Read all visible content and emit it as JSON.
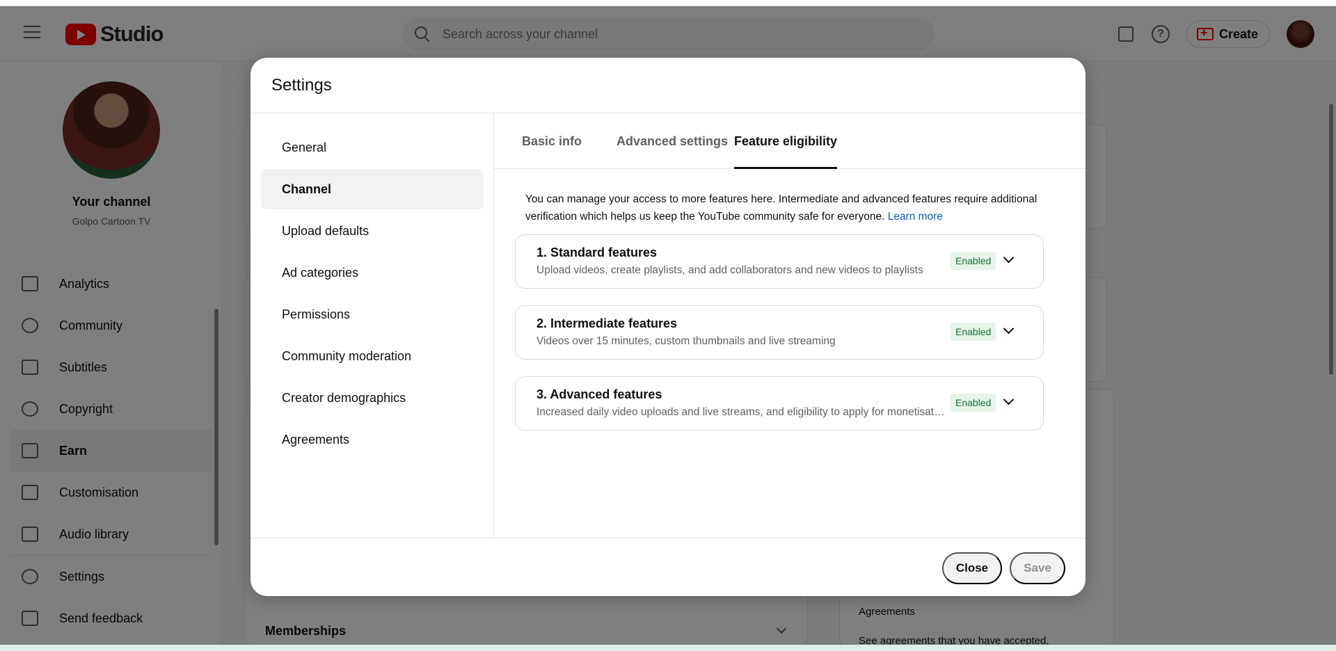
{
  "header": {
    "logo_text": "Studio",
    "search_placeholder": "Search across your channel",
    "create_label": "Create"
  },
  "sidebar": {
    "channel_title": "Your channel",
    "channel_name": "Golpo Cartoon TV",
    "items": [
      {
        "label": "Analytics",
        "icon": "analytics-icon"
      },
      {
        "label": "Community",
        "icon": "community-icon"
      },
      {
        "label": "Subtitles",
        "icon": "subtitles-icon"
      },
      {
        "label": "Copyright",
        "icon": "copyright-icon"
      },
      {
        "label": "Earn",
        "icon": "dollar-icon",
        "active": true
      },
      {
        "label": "Customisation",
        "icon": "magic-wand-icon"
      },
      {
        "label": "Audio library",
        "icon": "music-library-icon"
      }
    ],
    "bottom_items": [
      {
        "label": "Settings",
        "icon": "gear-icon"
      },
      {
        "label": "Send feedback",
        "icon": "feedback-icon"
      }
    ]
  },
  "background": {
    "memberships_label": "Memberships",
    "agreements_label": "Agreements",
    "agreements_text": "See agreements that you have accepted,"
  },
  "dialog": {
    "title": "Settings",
    "nav": [
      "General",
      "Channel",
      "Upload defaults",
      "Ad categories",
      "Permissions",
      "Community moderation",
      "Creator demographics",
      "Agreements"
    ],
    "active_nav": "Channel",
    "tabs": [
      "Basic info",
      "Advanced settings",
      "Feature eligibility"
    ],
    "active_tab": "Feature eligibility",
    "description": "You can manage your access to more features here. Intermediate and advanced features require additional verification which helps us keep the YouTube community safe for everyone.",
    "learn_more": "Learn more",
    "features": [
      {
        "title": "1. Standard features",
        "subtitle": "Upload videos, create playlists, and add collaborators and new videos to playlists",
        "status": "Enabled"
      },
      {
        "title": "2. Intermediate features",
        "subtitle": "Videos over 15 minutes, custom thumbnails and live streaming",
        "status": "Enabled"
      },
      {
        "title": "3. Advanced features",
        "subtitle": "Increased daily video uploads and live streams, and eligibility to apply for monetisation",
        "status": "Enabled"
      }
    ],
    "close_label": "Close",
    "save_label": "Save"
  },
  "colors": {
    "brand_red": "#ff0000",
    "badge_bg": "#e6f4ea",
    "badge_text": "#137333",
    "link": "#065fd4"
  }
}
